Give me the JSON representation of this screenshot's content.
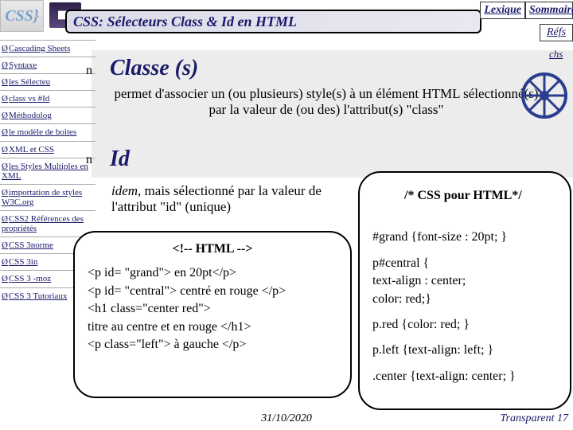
{
  "logo": {
    "css": "CSS",
    "brace": "}"
  },
  "title": "CSS: Sélecteurs Class & Id en HTML",
  "toplinks": {
    "lexique": "Lexique",
    "sommaire": "Sommaire",
    "refs": "Réfs",
    "tchs": "chs"
  },
  "sidebar": [
    "Cascading Sheets",
    "Syntaxe",
    "les Sélecteu",
    "class vs #Id",
    "Méthodolog",
    "le modèle de boites",
    "XML et CSS",
    "les Styles Multiples en XML",
    "importation de styles W3C.org",
    "CSS2 Références des propriétés",
    "CSS 3norme",
    "CSS 3in",
    "CSS 3 -moz",
    "CSS 3 Tutoriaux"
  ],
  "bullet": "n",
  "classe": {
    "head": "Classe (s)",
    "desc": "permet d'associer un (ou plusieurs) style(s) à un élément HTML sélectionné(s) par la valeur de (ou des) l'attribut(s) \"class\""
  },
  "id": {
    "head": "Id",
    "idem": "idem",
    "desc": ", mais sélectionné par la valeur de l'attribut \"id\" (unique)"
  },
  "html_box": {
    "hdr": "<!-- HTML -->",
    "l1": "<p id= \"grand\">  en 20pt</p>",
    "l2": "<p id= \"central\">  centré en rouge </p>",
    "l3": "<h1 class=\"center  red\">",
    "l4": "titre  au centre et en rouge </h1>",
    "l5": "<p class=\"left\"> à gauche </p>"
  },
  "css_box": {
    "hdr": "/* CSS pour HTML*/",
    "r1": "#grand {font-size : 20pt; }",
    "r2": "p#central {\ntext-align : center;\ncolor: red;}",
    "r3": "p.red {color: red; }",
    "r4": "p.left {text-align: left; }",
    "r5": ".center {text-align: center; }"
  },
  "footer": {
    "date": "31/10/2020",
    "transp": "Transparent 17"
  }
}
